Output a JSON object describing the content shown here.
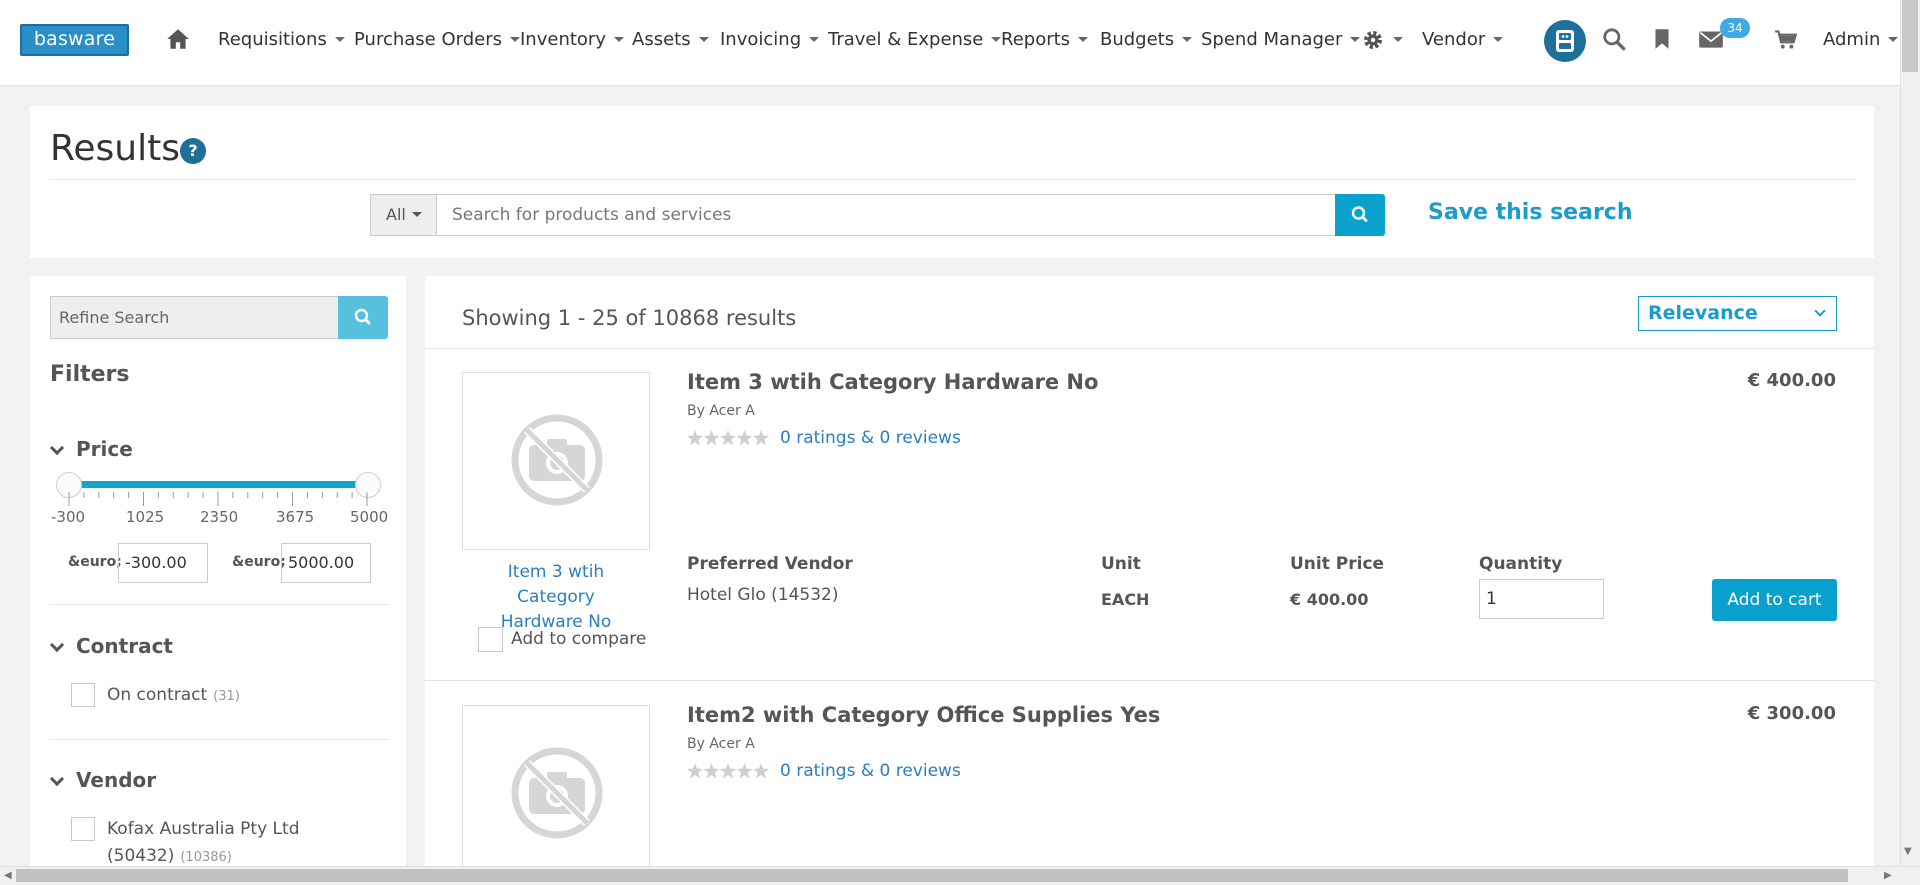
{
  "brand": {
    "logo_text": "basware"
  },
  "nav": {
    "items": [
      "Requisitions",
      "Purchase Orders",
      "Inventory",
      "Assets",
      "Invoicing",
      "Travel & Expense",
      "Reports",
      "Budgets",
      "Spend Manager",
      "Vendor"
    ],
    "messages_count": "34",
    "user": "Admin",
    "icons": [
      "home-icon",
      "gear-icon",
      "assistant-robot-icon",
      "search-icon",
      "bookmark-icon",
      "envelope-icon",
      "cart-icon"
    ]
  },
  "page": {
    "title": "Results",
    "help": "?"
  },
  "search": {
    "scope": "All",
    "placeholder": "Search for products and services",
    "save_label": "Save this search"
  },
  "sidebar": {
    "refine_placeholder": "Refine Search",
    "filters_title": "Filters",
    "price": {
      "title": "Price",
      "ticks": [
        "-300",
        "1025",
        "2350",
        "3675",
        "5000"
      ],
      "range_min": -300,
      "range_max": 5000,
      "min_value": "-300.00",
      "max_value": "5000.00",
      "currency_label": "&euro;"
    },
    "contract": {
      "title": "Contract",
      "option": "On contract",
      "count": "(31)"
    },
    "vendor": {
      "title": "Vendor",
      "option_line1": "Kofax Australia Pty Ltd",
      "option_line2": "(50432)",
      "count": "(10386)"
    }
  },
  "results": {
    "summary": "Showing 1 - 25 of 10868 results",
    "sort": "Relevance",
    "columns": {
      "vendor": "Preferred Vendor",
      "unit": "Unit",
      "unit_price": "Unit Price",
      "quantity": "Quantity"
    },
    "items": [
      {
        "title": "Item 3 wtih Category Hardware No",
        "link_line1": "Item 3 wtih Category",
        "link_line2": "Hardware No",
        "by": "By Acer A",
        "ratings": "0 ratings & 0 reviews",
        "price": "€ 400.00",
        "vendor": "Hotel Glo (14532)",
        "unit": "EACH",
        "unit_price": "€ 400.00",
        "quantity": "1",
        "add_label": "Add to cart",
        "compare_label": "Add to compare"
      },
      {
        "title": "Item2 with Category Office Supplies Yes",
        "by": "By Acer A",
        "ratings": "0 ratings & 0 reviews",
        "price": "€ 300.00"
      }
    ]
  }
}
